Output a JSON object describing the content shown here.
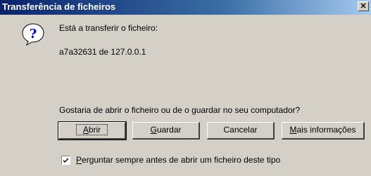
{
  "dialog": {
    "title": "Transferência de ficheiros",
    "close_glyph": "×"
  },
  "icons": {
    "question": "question-balloon-icon",
    "close": "close-icon",
    "check": "checkmark-icon"
  },
  "content": {
    "line1": "Está a transferir o ficheiro:",
    "line2": "a7a32631 de 127.0.0.1",
    "question": "Gostaria de abrir o ficheiro ou de o guardar no seu computador?"
  },
  "buttons": {
    "abrir": {
      "label": "Abrir",
      "mnemonic": "A",
      "rest": "brir"
    },
    "guardar": {
      "label": "Guardar",
      "mnemonic": "G",
      "rest": "uardar"
    },
    "cancelar": {
      "label": "Cancelar"
    },
    "mais": {
      "label": "Mais informações",
      "mnemonic": "M",
      "rest": "ais informações"
    }
  },
  "checkbox": {
    "checked": true,
    "label": "Perguntar sempre antes de abrir um ficheiro deste tipo",
    "mnemonic": "P",
    "rest": "erguntar sempre antes de abrir um ficheiro deste tipo"
  },
  "colors": {
    "title_start": "#0a246a",
    "title_end": "#a6caf0",
    "face": "#d4d0c8"
  }
}
